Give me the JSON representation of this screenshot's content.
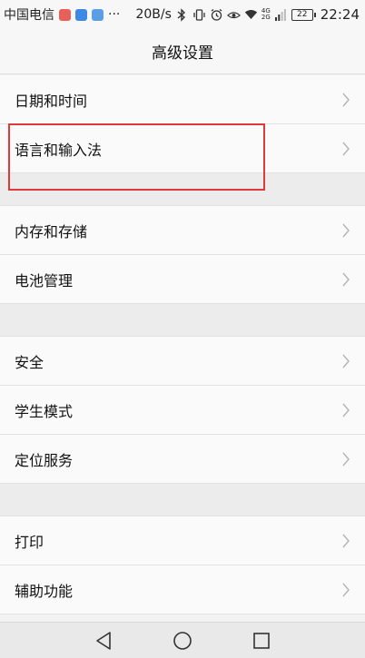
{
  "status_bar": {
    "carrier": "中国电信",
    "overflow": "···",
    "net_speed": "20B/s",
    "network": "4G",
    "network2": "2G",
    "battery": "22",
    "time": "22:24"
  },
  "header": {
    "title": "高级设置"
  },
  "groups": [
    {
      "items": [
        {
          "label": "日期和时间"
        },
        {
          "label": "语言和输入法"
        }
      ]
    },
    {
      "items": [
        {
          "label": "内存和存储"
        },
        {
          "label": "电池管理"
        }
      ]
    },
    {
      "items": [
        {
          "label": "安全"
        },
        {
          "label": "学生模式"
        },
        {
          "label": "定位服务"
        }
      ]
    },
    {
      "items": [
        {
          "label": "打印"
        },
        {
          "label": "辅助功能"
        }
      ]
    }
  ],
  "highlight_color": "#e0383b"
}
